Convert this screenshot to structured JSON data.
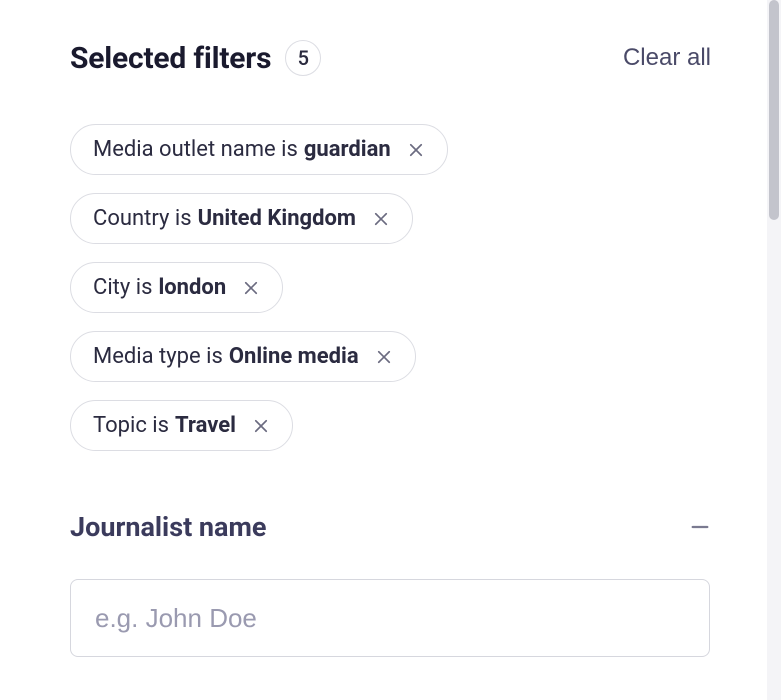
{
  "header": {
    "title": "Selected filters",
    "count": "5",
    "clear_all": "Clear all"
  },
  "chips": [
    {
      "label": "Media outlet name is",
      "value": "guardian"
    },
    {
      "label": "Country is",
      "value": "United Kingdom"
    },
    {
      "label": "City is",
      "value": "london"
    },
    {
      "label": "Media type is",
      "value": "Online media"
    },
    {
      "label": "Topic is",
      "value": "Travel"
    }
  ],
  "accordion": {
    "title": "Journalist name"
  },
  "search": {
    "placeholder": "e.g. John Doe",
    "value": ""
  }
}
